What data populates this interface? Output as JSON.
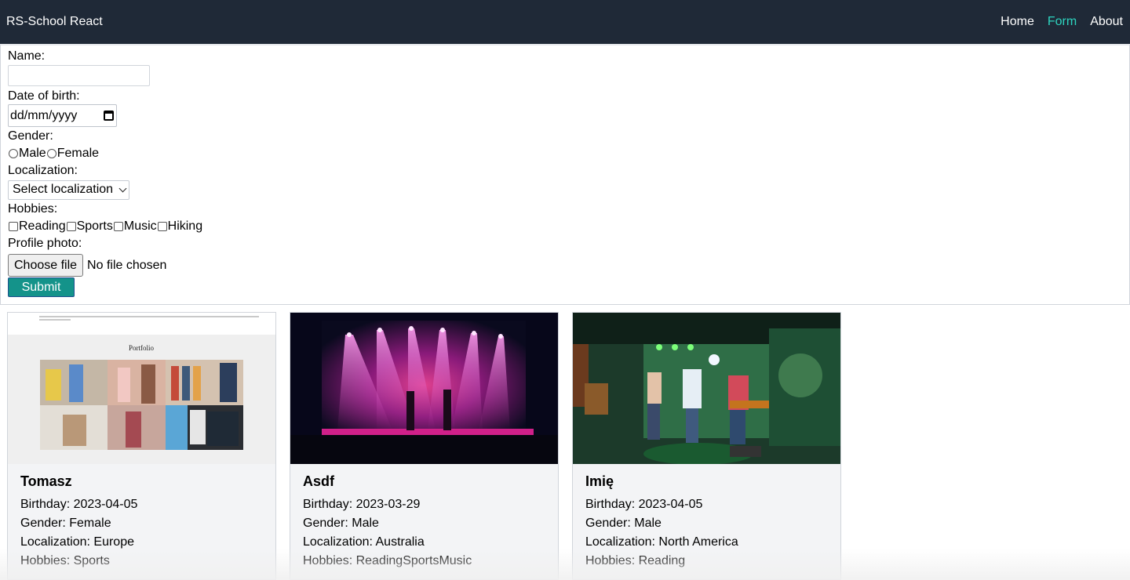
{
  "navbar": {
    "brand": "RS-School React",
    "links": [
      {
        "label": "Home",
        "active": false
      },
      {
        "label": "Form",
        "active": true
      },
      {
        "label": "About",
        "active": false
      }
    ]
  },
  "form": {
    "name_label": "Name:",
    "name_value": "",
    "dob_label": "Date of birth:",
    "dob_placeholder": "dd/mm/yyyy",
    "gender_label": "Gender:",
    "gender_options": [
      "Male",
      "Female"
    ],
    "localization_label": "Localization:",
    "localization_selected": "Select localization",
    "hobbies_label": "Hobbies:",
    "hobbies_options": [
      "Reading",
      "Sports",
      "Music",
      "Hiking"
    ],
    "photo_label": "Profile photo:",
    "choose_file_label": "Choose file",
    "file_status": "No file chosen",
    "submit_label": "Submit"
  },
  "cards": [
    {
      "name": "Tomasz",
      "birthday": "Birthday: 2023-04-05",
      "gender": "Gender: Female",
      "localization": "Localization: Europe",
      "hobbies": "Hobbies: Sports",
      "image_caption": "Portfolio"
    },
    {
      "name": "Asdf",
      "birthday": "Birthday: 2023-03-29",
      "gender": "Gender: Male",
      "localization": "Localization: Australia",
      "hobbies": "Hobbies: ReadingSportsMusic"
    },
    {
      "name": "Imię",
      "birthday": "Birthday: 2023-04-05",
      "gender": "Gender: Male",
      "localization": "Localization: North America",
      "hobbies": "Hobbies: Reading"
    }
  ],
  "colors": {
    "navbar_bg": "#1f2937",
    "nav_active": "#2dd4bf",
    "submit_bg": "#14938a",
    "card_bg": "#f3f4f6"
  }
}
